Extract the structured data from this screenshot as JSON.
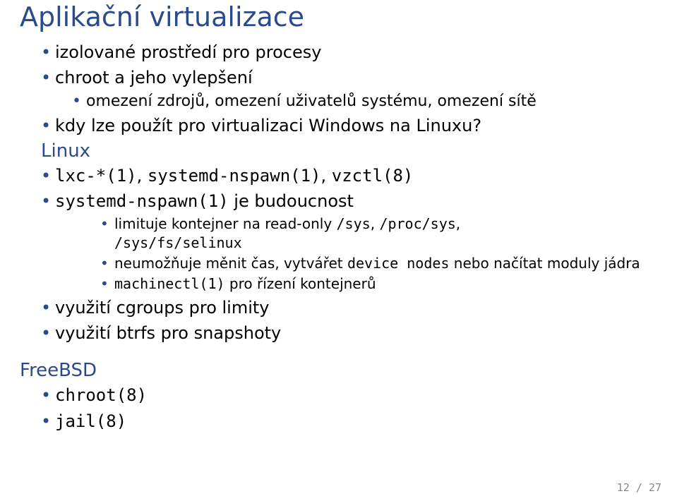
{
  "title": "Aplikační virtualizace",
  "bullets": {
    "b1": "izolované prostředí pro procesy",
    "b2": "chroot a jeho vylepšení",
    "b2_1": "omezení zdrojů, omezení uživatelů systému, omezení sítě",
    "b3": "kdy lze použít pro virtualizaci Windows na Linuxu?"
  },
  "linux": {
    "heading": "Linux",
    "l1_pre": "lxc-*(1)",
    "l1_mid": ", ",
    "l1_sp": "systemd-nspawn(1)",
    "l1_mid2": ", ",
    "l1_vz": "vzctl(8)",
    "l2_sp": "systemd-nspawn(1)",
    "l2_tail": " je budoucnost",
    "l2_1a": "limituje kontejner na read-only ",
    "l2_1b": "/sys",
    "l2_1c": ", ",
    "l2_1d": "/proc/sys",
    "l2_1e": ", ",
    "l2_1f": "/sys/fs/selinux",
    "l2_2a": "neumožňuje měnit čas, vytvářet ",
    "l2_2b": "device nodes",
    "l2_2c": " nebo načítat moduly jádra",
    "l2_3a": "machinectl(1)",
    "l2_3b": " pro řízení kontejnerů",
    "l3": "využití cgroups pro limity",
    "l4": "využití btrfs pro snapshoty"
  },
  "freebsd": {
    "heading": "FreeBSD",
    "f1": "chroot(8)",
    "f2": "jail(8)"
  },
  "pagenum": "12 / 27"
}
